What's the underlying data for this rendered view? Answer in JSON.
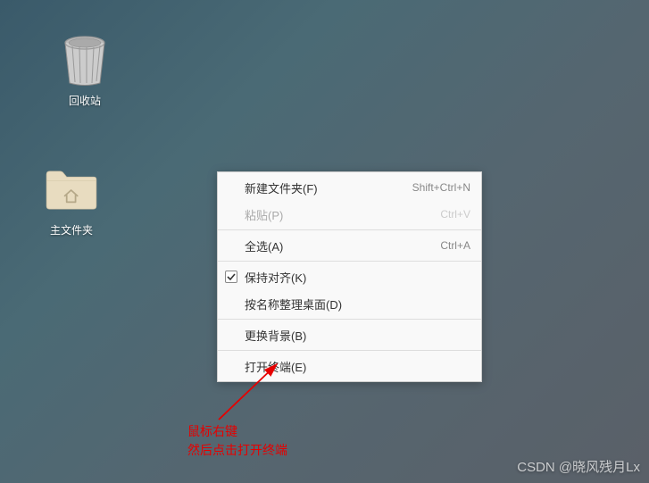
{
  "desktop": {
    "trash_label": "回收站",
    "home_label": "主文件夹"
  },
  "menu": {
    "new_folder": {
      "label": "新建文件夹(F)",
      "shortcut": "Shift+Ctrl+N"
    },
    "paste": {
      "label": "粘贴(P)",
      "shortcut": "Ctrl+V"
    },
    "select_all": {
      "label": "全选(A)",
      "shortcut": "Ctrl+A"
    },
    "keep_aligned": {
      "label": "保持对齐(K)"
    },
    "organize": {
      "label": "按名称整理桌面(D)"
    },
    "change_bg": {
      "label": "更换背景(B)"
    },
    "open_terminal": {
      "label": "打开终端(E)"
    }
  },
  "annotation": {
    "line1": "鼠标右键",
    "line2": "然后点击打开终端"
  },
  "watermark": "CSDN @晓风残月Lx"
}
